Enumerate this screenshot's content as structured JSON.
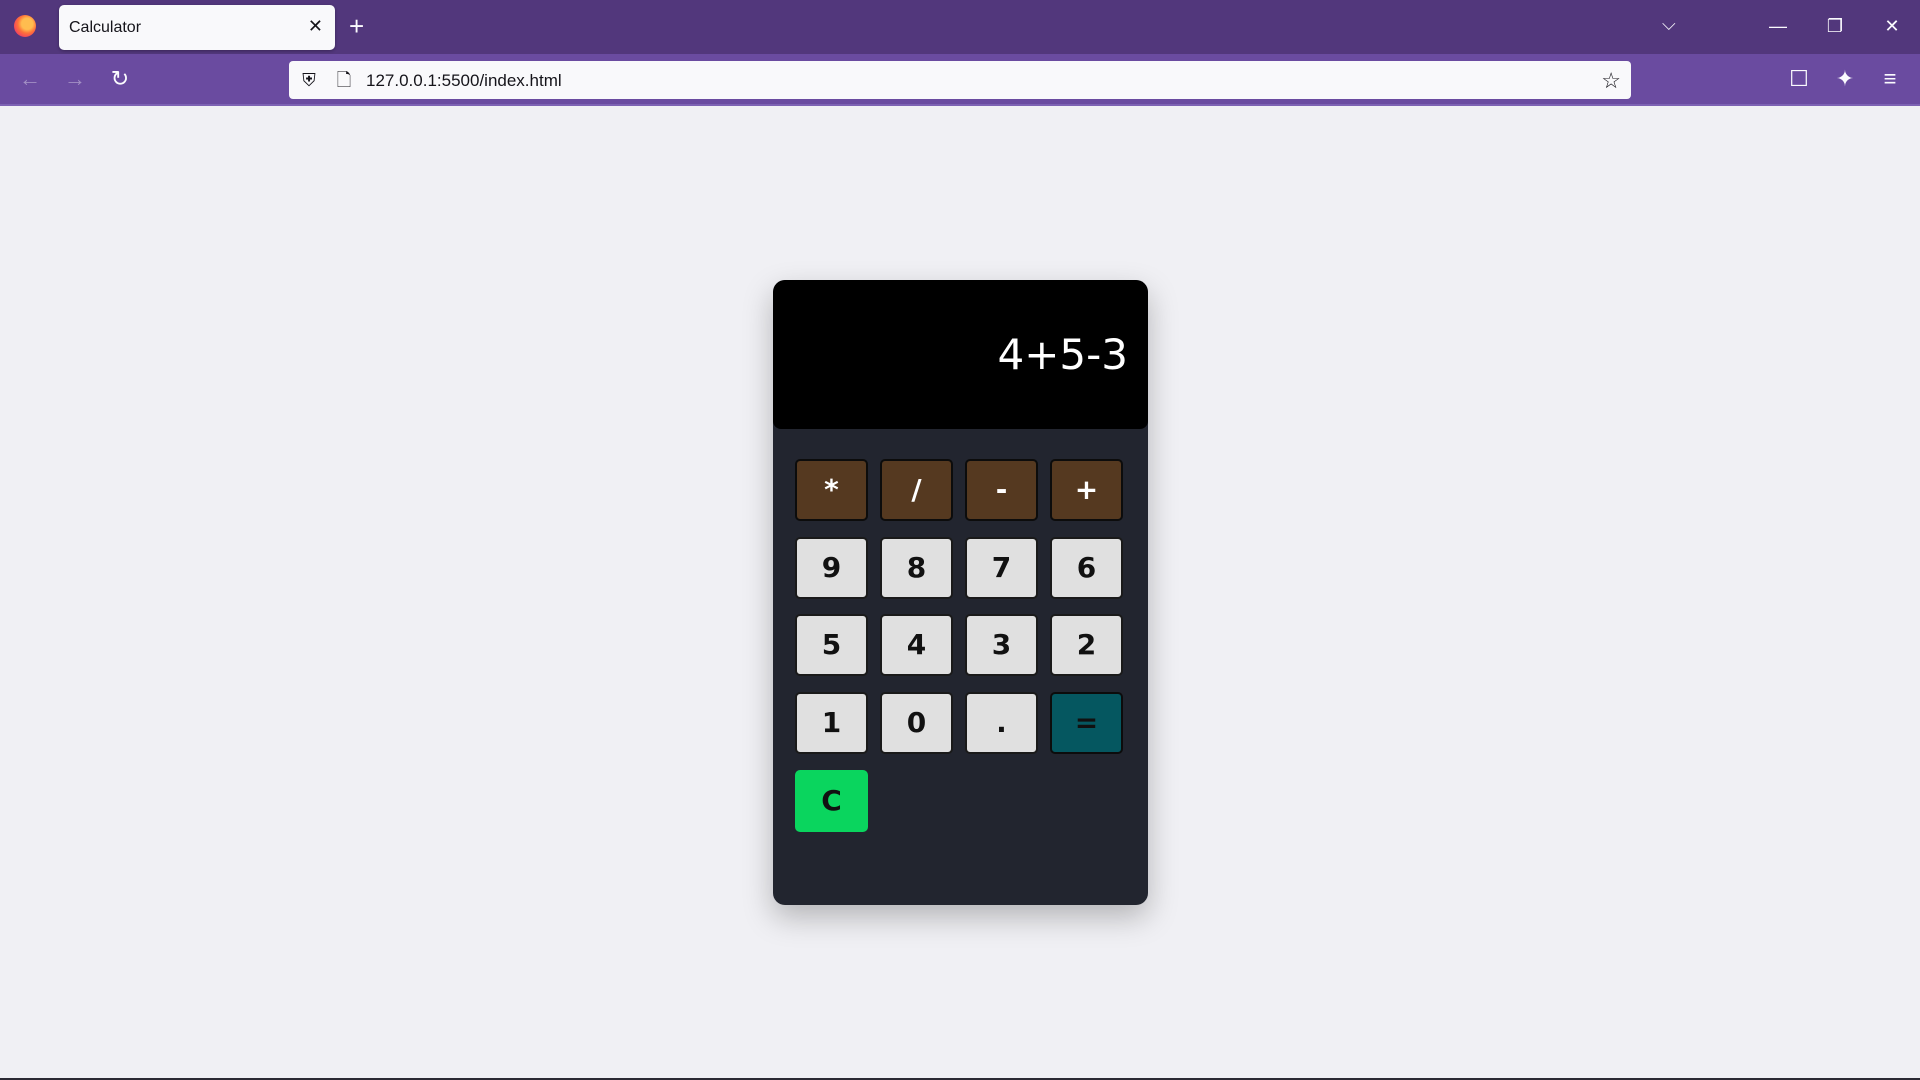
{
  "browser": {
    "tab_title": "Calculator",
    "tab_close": "✕",
    "new_tab": "+",
    "url": "127.0.0.1:5500/index.html",
    "accent_titlebar": "#52377c",
    "accent_navbar": "#6a4ba0"
  },
  "calculator": {
    "display": "4+5-3",
    "operators": [
      "*",
      "/",
      "-",
      "+"
    ],
    "row1": [
      "9",
      "8",
      "7",
      "6"
    ],
    "row2": [
      "5",
      "4",
      "3",
      "2"
    ],
    "row3": [
      "1",
      "0",
      "."
    ],
    "equals": "=",
    "clear": "C",
    "colors": {
      "body": "#22252f",
      "display": "#000000",
      "operator": "#553920",
      "number": "#e0e0e0",
      "equals": "#055760",
      "clear": "#0ad55e"
    }
  }
}
